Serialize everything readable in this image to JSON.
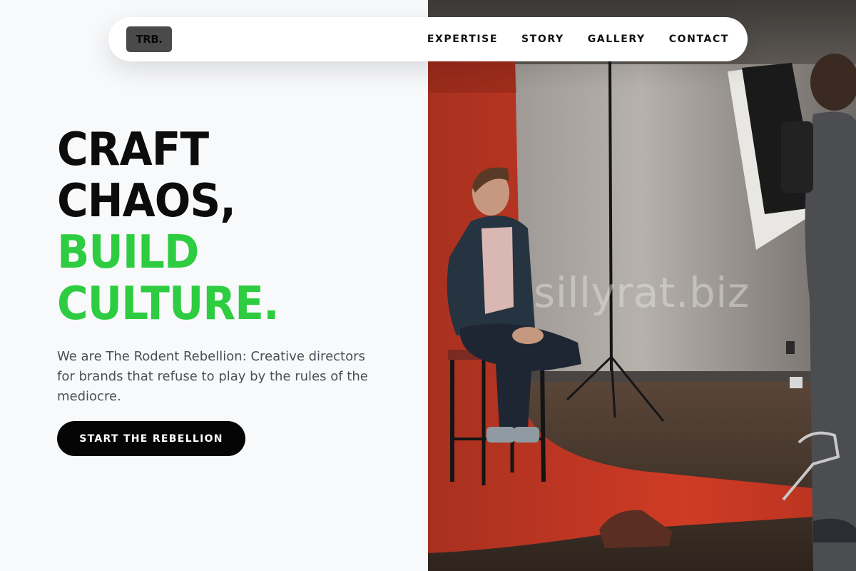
{
  "nav": {
    "logo": "TRB.",
    "items": [
      {
        "label": "EXPERTISE"
      },
      {
        "label": "STORY"
      },
      {
        "label": "GALLERY"
      },
      {
        "label": "CONTACT"
      }
    ]
  },
  "hero": {
    "headline_line1": "CRAFT",
    "headline_line2": "CHAOS,",
    "headline_line3": "BUILD",
    "headline_line4": "CULTURE.",
    "description": "We are The Rodent Rebellion: Creative directors for brands that refuse to play by the rules of the mediocre.",
    "cta_label": "START THE REBELLION"
  },
  "photo": {
    "alt": "Photo studio: man seated on stool before red backdrop, photographer with softbox",
    "watermark": "sillyrat.biz"
  },
  "colors": {
    "accent_green": "#2ecc40",
    "headline_dark": "#0c0c0c",
    "cta_bg": "#050505",
    "backdrop_red": "#c7331f"
  }
}
